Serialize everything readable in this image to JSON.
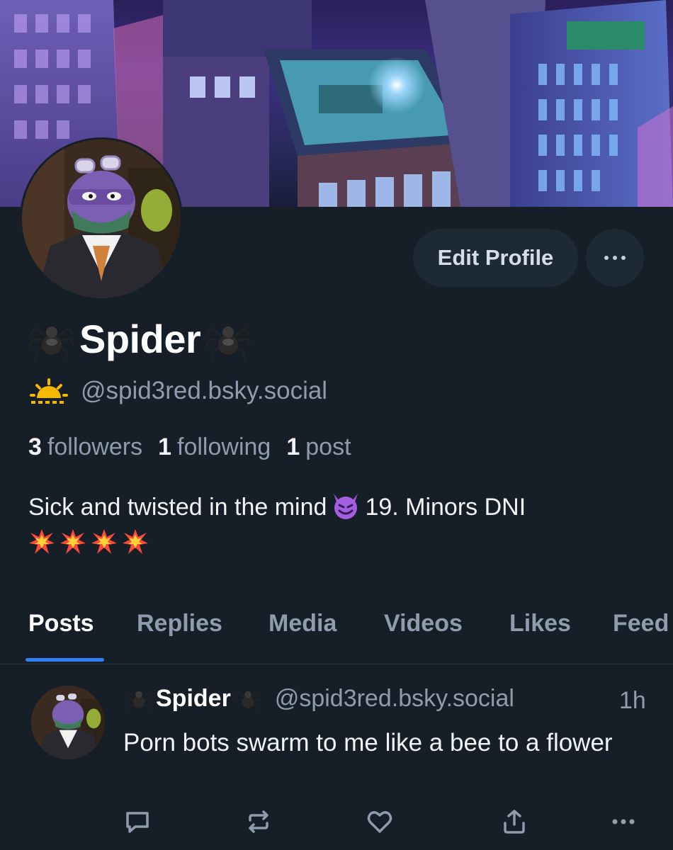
{
  "profile": {
    "display_name": "Spider",
    "handle": "@spid3red.bsky.social",
    "stats": {
      "followers_count": "3",
      "followers_label": "followers",
      "following_count": "1",
      "following_label": "following",
      "posts_count": "1",
      "posts_label": "post"
    },
    "bio_text_1": "Sick and twisted in the mind",
    "bio_text_2": "19. Minors DNI"
  },
  "actions": {
    "edit_profile_label": "Edit Profile"
  },
  "tabs": [
    {
      "label": "Posts",
      "active": true
    },
    {
      "label": "Replies"
    },
    {
      "label": "Media"
    },
    {
      "label": "Videos"
    },
    {
      "label": "Likes"
    },
    {
      "label": "Feed"
    }
  ],
  "post": {
    "author_name": "Spider",
    "author_handle": "@spid3red.bsky.social",
    "time": "1h",
    "text": "Porn bots swarm to me like a bee to a flower",
    "icons": [
      "reply-icon",
      "repost-icon",
      "like-icon",
      "share-icon",
      "more-icon"
    ]
  },
  "colors": {
    "background": "#161e27",
    "accent": "#2f81f7",
    "muted": "#8e9cad"
  }
}
